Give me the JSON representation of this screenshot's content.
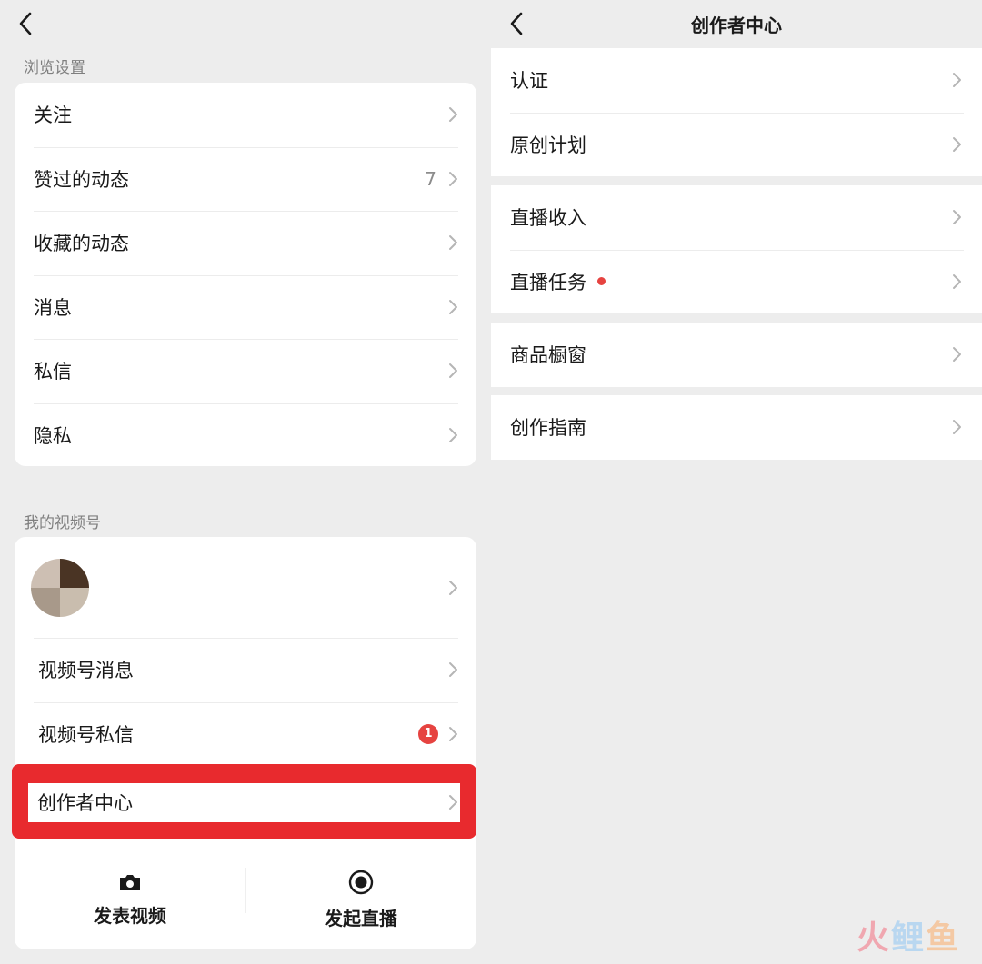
{
  "left": {
    "section_browse": "浏览设置",
    "browse_items": [
      {
        "label": "关注"
      },
      {
        "label": "赞过的动态",
        "count": "7"
      },
      {
        "label": "收藏的动态"
      },
      {
        "label": "消息"
      },
      {
        "label": "私信"
      },
      {
        "label": "隐私"
      }
    ],
    "section_channels": "我的视频号",
    "channel_items": [
      {
        "label": "视频号消息"
      },
      {
        "label": "视频号私信",
        "badge": "1"
      },
      {
        "label": "创作者中心"
      }
    ],
    "actions": [
      {
        "label": "发表视频",
        "icon": "camera-icon"
      },
      {
        "label": "发起直播",
        "icon": "live-record-icon"
      }
    ]
  },
  "right": {
    "title": "创作者中心",
    "groups": [
      [
        "认证",
        "原创计划"
      ],
      [
        "直播收入",
        "直播任务"
      ],
      [
        "商品橱窗"
      ],
      [
        "创作指南"
      ]
    ]
  },
  "watermark": {
    "c1": "火",
    "c2": "鲤",
    "c3": "鱼"
  },
  "colors": {
    "background": "#ededed",
    "highlight": "#e82a2e",
    "badge": "#e64340"
  }
}
